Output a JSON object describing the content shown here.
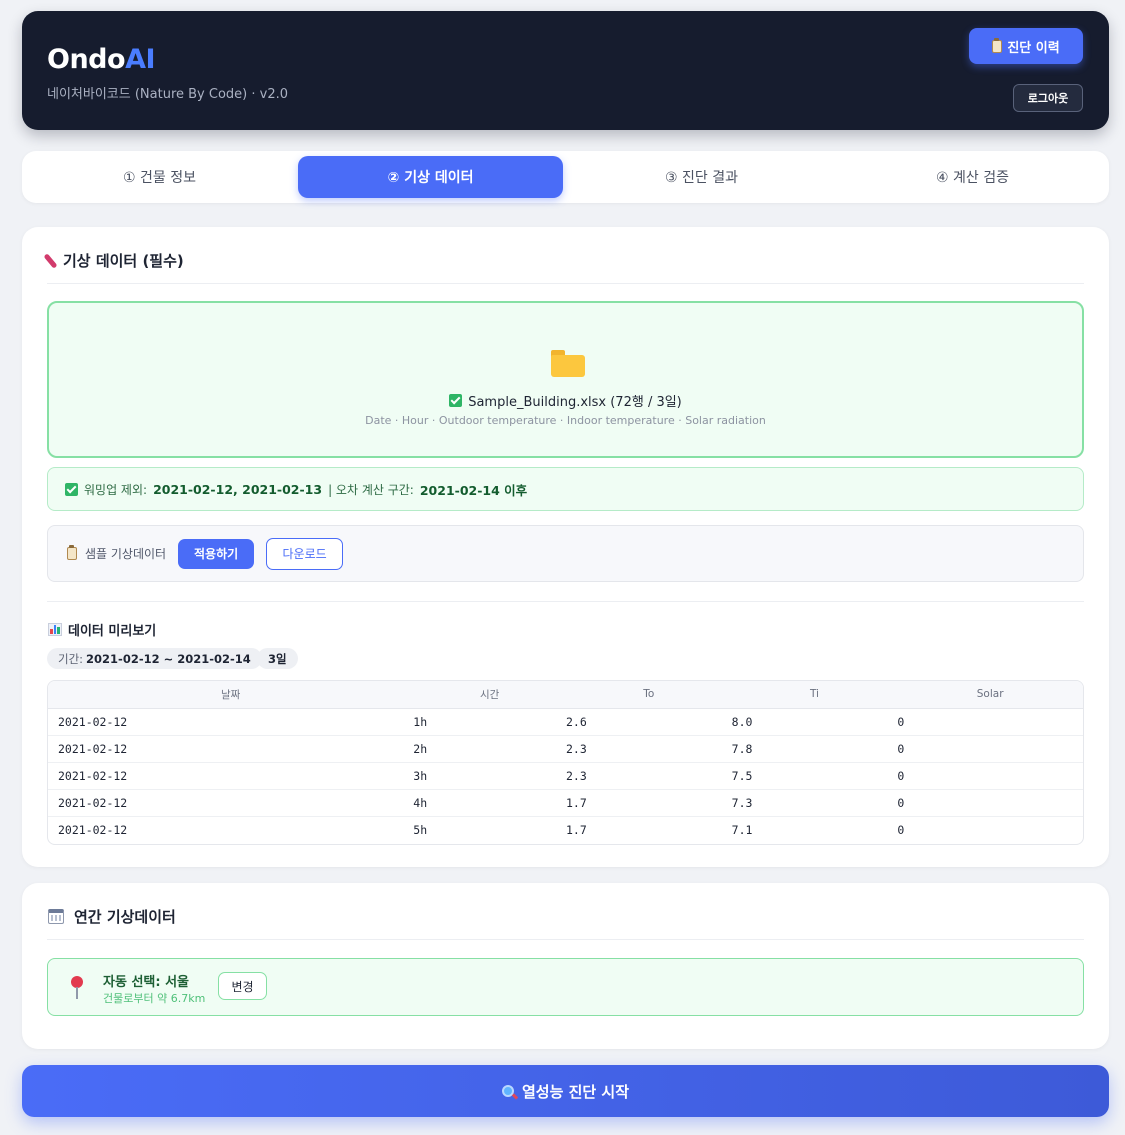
{
  "header": {
    "brand_main": "Ondo",
    "brand_accent": "AI",
    "subtitle": "네이처바이코드 (Nature By Code) · v2.0",
    "history_button": "진단 이력",
    "logout_button": "로그아웃"
  },
  "tabs": [
    {
      "label": "① 건물 정보",
      "active": false
    },
    {
      "label": "② 기상 데이터",
      "active": true
    },
    {
      "label": "③ 진단 결과",
      "active": false
    },
    {
      "label": "④ 계산 검증",
      "active": false
    }
  ],
  "weather_card": {
    "title": "기상 데이터 (필수)",
    "upload": {
      "file": "Sample_Building.xlsx (72행 / 3일)",
      "columns": "Date · Hour · Outdoor temperature · Indoor temperature · Solar radiation"
    },
    "warmup": {
      "label": "워밍업 제외:",
      "dates": "2021-02-12, 2021-02-13",
      "separator": "| 오차 계산 구간:",
      "range": "2021-02-14 이후"
    },
    "sample": {
      "label": "샘플 기상데이터",
      "apply_button": "적용하기",
      "download_button": "다운로드"
    },
    "preview": {
      "title": "데이터 미리보기",
      "period_label": "기간:",
      "period_value": "2021-02-12 ~ 2021-02-14",
      "days": "3일",
      "columns": [
        "날짜",
        "시간",
        "To",
        "Ti",
        "Solar"
      ],
      "rows": [
        [
          "2021-02-12",
          "1h",
          "2.6",
          "8.0",
          "0"
        ],
        [
          "2021-02-12",
          "2h",
          "2.3",
          "7.8",
          "0"
        ],
        [
          "2021-02-12",
          "3h",
          "2.3",
          "7.5",
          "0"
        ],
        [
          "2021-02-12",
          "4h",
          "1.7",
          "7.3",
          "0"
        ],
        [
          "2021-02-12",
          "5h",
          "1.7",
          "7.1",
          "0"
        ]
      ]
    }
  },
  "annual_card": {
    "title": "연간 기상데이터",
    "station_name": "자동 선택: 서울",
    "station_distance": "건물로부터 약 6.7km",
    "change_button": "변경"
  },
  "start_button": "열성능 진단 시작",
  "colors": {
    "accent": "#4a6cf7",
    "header_bg": "#161c2e",
    "success_bg": "#f0fdf4",
    "success_border": "#86e0a4"
  }
}
